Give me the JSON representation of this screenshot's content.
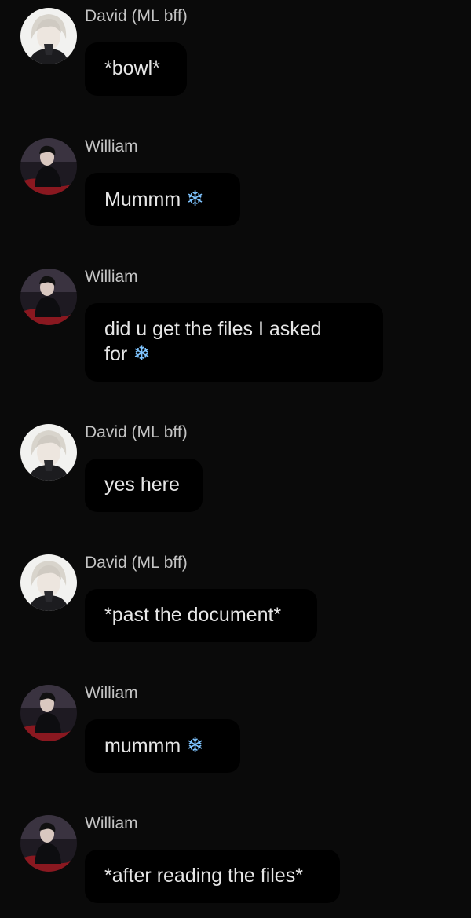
{
  "messages": [
    {
      "sender": "David (ML bff)",
      "avatar": "david-avatar",
      "text": "*bowl*",
      "emoji": ""
    },
    {
      "sender": "William",
      "avatar": "william-avatar",
      "text": "Mummm",
      "emoji": "❄"
    },
    {
      "sender": "William",
      "avatar": "william-avatar",
      "text": "did u get the files I asked for",
      "emoji": "❄"
    },
    {
      "sender": "David (ML bff)",
      "avatar": "david-avatar",
      "text": "yes here",
      "emoji": ""
    },
    {
      "sender": "David (ML bff)",
      "avatar": "david-avatar",
      "text": "*past the document*",
      "emoji": ""
    },
    {
      "sender": "William",
      "avatar": "william-avatar",
      "text": "mummm",
      "emoji": "❄"
    },
    {
      "sender": "William",
      "avatar": "william-avatar",
      "text": "*after reading the files*",
      "emoji": ""
    }
  ],
  "colors": {
    "background": "#0a0a0a",
    "bubble": "#000000",
    "name_text": "#c4c4c4",
    "message_text": "#e6e6e6",
    "snowflake": "#7fc4ff"
  }
}
